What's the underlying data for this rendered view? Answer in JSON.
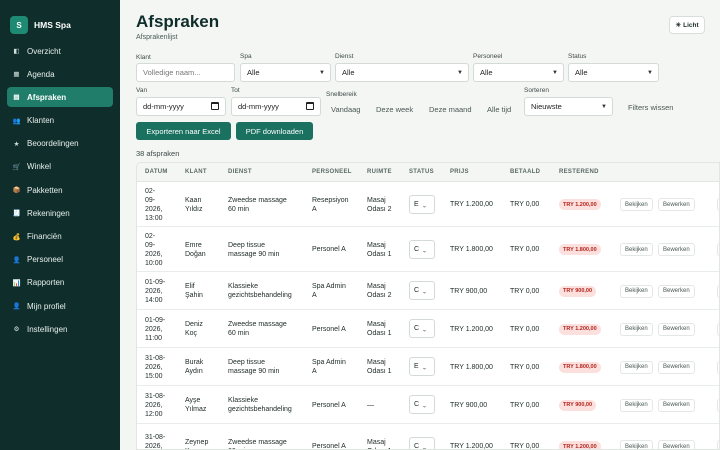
{
  "brand": {
    "logo": "S",
    "name": "HMS Spa"
  },
  "nav": [
    {
      "label": "Overzicht",
      "icon": "◧",
      "icon_name": "overview-icon"
    },
    {
      "label": "Agenda",
      "icon": "▦",
      "icon_name": "calendar-icon"
    },
    {
      "label": "Afspraken",
      "icon": "▤",
      "icon_name": "list-icon"
    },
    {
      "label": "Klanten",
      "icon": "👥",
      "icon_name": "clients-icon"
    },
    {
      "label": "Beoordelingen",
      "icon": "★",
      "icon_name": "star-icon"
    },
    {
      "label": "Winkel",
      "icon": "🛒",
      "icon_name": "cart-icon"
    },
    {
      "label": "Pakketten",
      "icon": "📦",
      "icon_name": "package-icon"
    },
    {
      "label": "Rekeningen",
      "icon": "🧾",
      "icon_name": "receipt-icon"
    },
    {
      "label": "Financiën",
      "icon": "💰",
      "icon_name": "money-bag-icon"
    },
    {
      "label": "Personeel",
      "icon": "👤",
      "icon_name": "staff-icon"
    },
    {
      "label": "Rapporten",
      "icon": "📊",
      "icon_name": "chart-icon"
    },
    {
      "label": "Mijn profiel",
      "icon": "👤",
      "icon_name": "profile-icon"
    },
    {
      "label": "Instellingen",
      "icon": "⚙",
      "icon_name": "gear-icon"
    }
  ],
  "active_nav": "Afspraken",
  "header": {
    "title": "Afspraken",
    "subtitle": "Afsprakenlijst",
    "theme_icon": "☀",
    "theme_label": "Licht"
  },
  "filters": {
    "client_label": "Klant",
    "client_placeholder": "Volledige naam...",
    "spa_label": "Spa",
    "spa_value": "Alle",
    "service_label": "Dienst",
    "service_value": "Alle",
    "staff_label": "Personeel",
    "staff_value": "Alle",
    "status_label": "Status",
    "status_value": "Alle",
    "from_label": "Van",
    "from_value": "dd-mm-yyyy",
    "to_label": "Tot",
    "to_value": "dd-mm-yyyy",
    "quick_label": "Snelbereik",
    "quick": [
      "Vandaag",
      "Deze week",
      "Deze maand",
      "Alle tijd"
    ],
    "sort_label": "Sorteren",
    "sort_value": "Nieuwste",
    "clear_label": "Filters wissen"
  },
  "buttons": {
    "export_excel": "Exporteren naar Excel",
    "pdf": "PDF downloaden"
  },
  "count_text": "38 afspraken",
  "table": {
    "columns": [
      "DATUM",
      "KLANT",
      "DIENST",
      "PERSONEEL",
      "RUIMTE",
      "STATUS",
      "PRIJS",
      "BETAALD",
      "RESTEREND"
    ],
    "actions": {
      "view": "Bekijken",
      "edit": "Bewerken"
    },
    "rows": [
      {
        "date": [
          "02-",
          "09-",
          "2026,",
          "13:00"
        ],
        "client": [
          "Kaan",
          "Yıldız"
        ],
        "service": [
          "Zweedse massage",
          "60 min"
        ],
        "staff": [
          "Resepsiyon",
          "A"
        ],
        "room": [
          "Masaj",
          "Odası 2"
        ],
        "status": "E",
        "price": "TRY 1.200,00",
        "paid": "TRY 0,00",
        "remaining": "TRY 1.200,00"
      },
      {
        "date": [
          "02-",
          "09-",
          "2026,",
          "10:00"
        ],
        "client": [
          "Emre",
          "Doğan"
        ],
        "service": [
          "Deep tissue",
          "massage 90 min"
        ],
        "staff": [
          "Personel A"
        ],
        "room": [
          "Masaj",
          "Odası 1"
        ],
        "status": "C",
        "price": "TRY 1.800,00",
        "paid": "TRY 0,00",
        "remaining": "TRY 1.800,00"
      },
      {
        "date": [
          "01-09-",
          "2026,",
          "14:00"
        ],
        "client": [
          "Elif",
          "Şahin"
        ],
        "service": [
          "Klassieke",
          "gezichtsbehandeling"
        ],
        "staff": [
          "Spa Admin",
          "A"
        ],
        "room": [
          "Masaj",
          "Odası 2"
        ],
        "status": "C",
        "price": "TRY 900,00",
        "paid": "TRY 0,00",
        "remaining": "TRY 900,00"
      },
      {
        "date": [
          "01-09-",
          "2026,",
          "11:00"
        ],
        "client": [
          "Deniz",
          "Koç"
        ],
        "service": [
          "Zweedse massage",
          "60 min"
        ],
        "staff": [
          "Personel A"
        ],
        "room": [
          "Masaj",
          "Odası 1"
        ],
        "status": "C",
        "price": "TRY 1.200,00",
        "paid": "TRY 0,00",
        "remaining": "TRY 1.200,00"
      },
      {
        "date": [
          "31-08-",
          "2026,",
          "15:00"
        ],
        "client": [
          "Burak",
          "Aydın"
        ],
        "service": [
          "Deep tissue",
          "massage 90 min"
        ],
        "staff": [
          "Spa Admin",
          "A"
        ],
        "room": [
          "Masaj",
          "Odası 1"
        ],
        "status": "E",
        "price": "TRY 1.800,00",
        "paid": "TRY 0,00",
        "remaining": "TRY 1.800,00"
      },
      {
        "date": [
          "31-08-",
          "2026,",
          "12:00"
        ],
        "client": [
          "Ayşe",
          "Yılmaz"
        ],
        "service": [
          "Klassieke",
          "gezichtsbehandeling"
        ],
        "staff": [
          "Personel A"
        ],
        "room": [
          "—"
        ],
        "status": "C",
        "price": "TRY 900,00",
        "paid": "TRY 0,00",
        "remaining": "TRY 900,00"
      },
      {
        "date": [
          "31-08-",
          "2026,",
          "10:00"
        ],
        "client": [
          "Zeynep",
          "Kaya"
        ],
        "service": [
          "Zweedse massage",
          "60 min"
        ],
        "staff": [
          "Personel A"
        ],
        "room": [
          "Masaj",
          "Odası 1"
        ],
        "status": "C",
        "price": "TRY 1.200,00",
        "paid": "TRY 0,00",
        "remaining": "TRY 1.200,00"
      }
    ]
  }
}
